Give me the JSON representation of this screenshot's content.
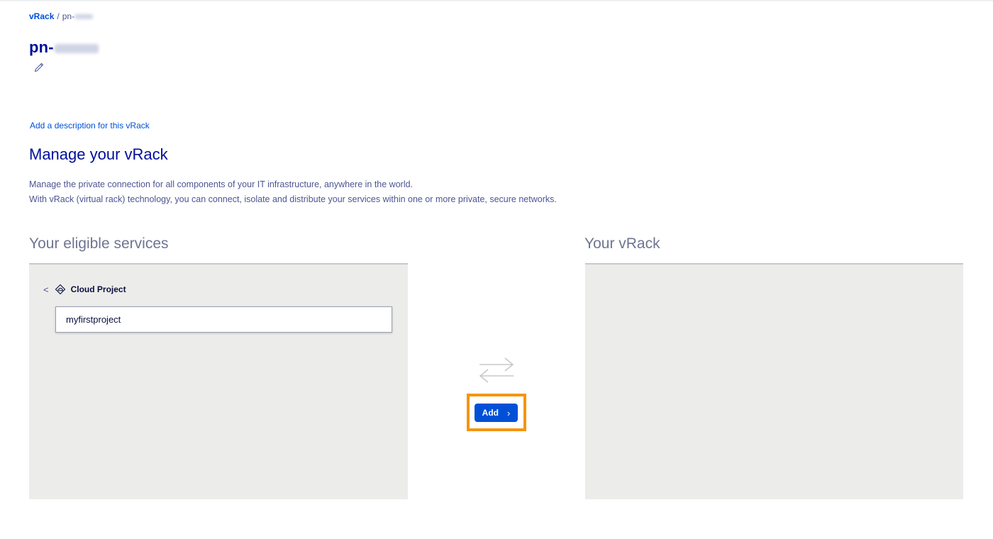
{
  "breadcrumb": {
    "root": "vRack",
    "separator": "/",
    "current_prefix": "pn-"
  },
  "page": {
    "title_prefix": "pn-",
    "add_description_link": "Add a description for this vRack"
  },
  "manage": {
    "title": "Manage your vRack",
    "description_line1": "Manage the private connection for all components of your IT infrastructure, anywhere in the world.",
    "description_line2": "With vRack (virtual rack) technology, you can connect, isolate and distribute your services within one or more private, secure networks."
  },
  "eligible": {
    "title": "Your eligible services",
    "back_symbol": "<",
    "category_label": "Cloud Project",
    "items": [
      {
        "label": "myfirstproject"
      }
    ]
  },
  "vrack": {
    "title": "Your vRack"
  },
  "actions": {
    "add_label": "Add",
    "add_chevron": "›"
  },
  "colors": {
    "primary": "#0050d7",
    "title": "#000e9c",
    "highlight": "#f7940c",
    "panel_bg": "#ecedea"
  },
  "icons": {
    "edit": "pencil-icon",
    "category": "cloud-project-icon",
    "transfer": "transfer-arrows-icon"
  }
}
